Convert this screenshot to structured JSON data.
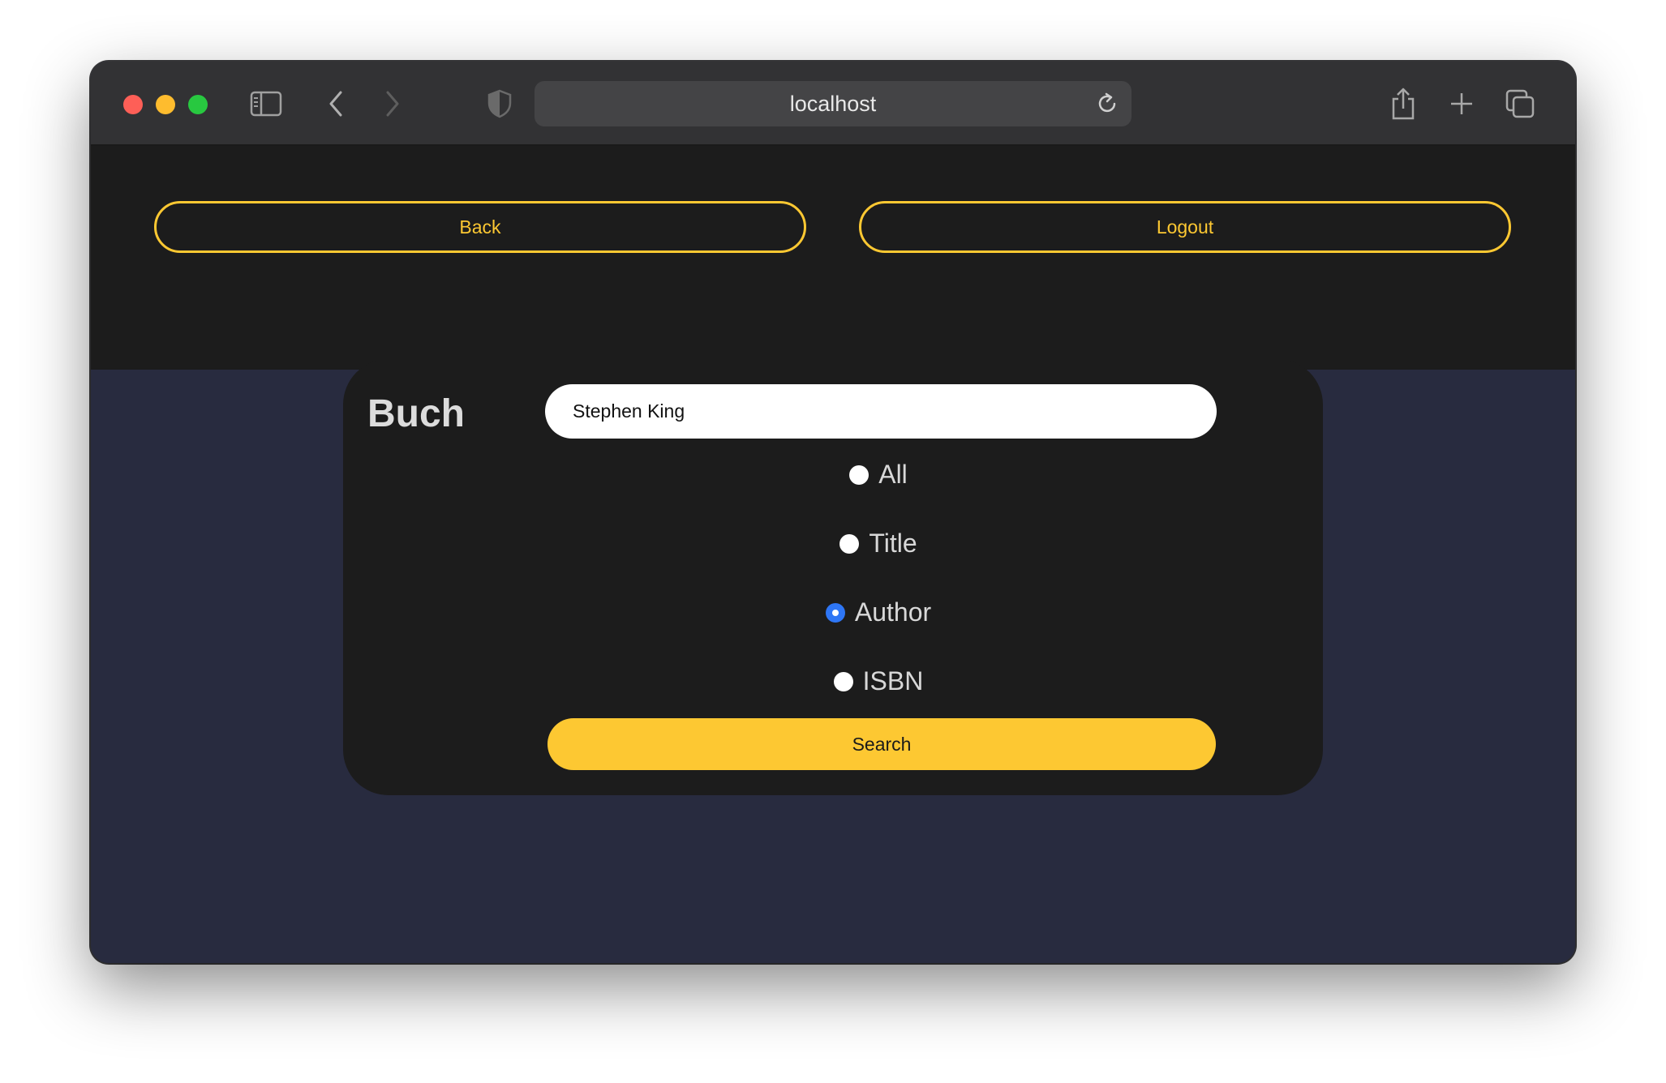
{
  "browser": {
    "address": "localhost",
    "colors": {
      "close": "#fe5f57",
      "minimize": "#febc2e",
      "zoom": "#28c840"
    },
    "icons": [
      "sidebar-icon",
      "back-arrow-icon",
      "forward-arrow-icon",
      "shield-icon",
      "reload-icon",
      "share-icon",
      "new-tab-icon",
      "tab-overview-icon"
    ]
  },
  "header": {
    "back_label": "Back",
    "logout_label": "Logout",
    "accent": "#fdc832"
  },
  "search_card": {
    "title": "Buch",
    "query": "Stephen King",
    "options": [
      {
        "label": "All",
        "checked": false
      },
      {
        "label": "Title",
        "checked": false
      },
      {
        "label": "Author",
        "checked": true
      },
      {
        "label": "ISBN",
        "checked": false
      }
    ],
    "search_label": "Search"
  }
}
